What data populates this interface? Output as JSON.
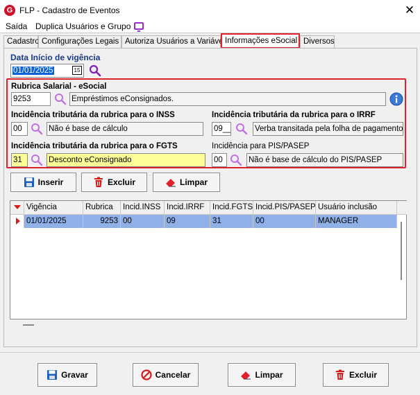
{
  "window": {
    "title": "FLP - Cadastro de Eventos",
    "logo_letter": "G",
    "close": "✕"
  },
  "menu": {
    "saida": "Saída",
    "duplica": "Duplica Usuários e Grupo"
  },
  "tabs": [
    "Cadastro",
    "Configurações Legais",
    "Autoriza Usuários a Variáveis",
    "Informações eSocial",
    "Diversos"
  ],
  "vigencia": {
    "label": "Data Início de vigência",
    "value": "01/01/2025",
    "cal": "15"
  },
  "rubrica": {
    "label": "Rubrica Salarial - eSocial",
    "code": "9253",
    "desc": "Empréstimos eConsignados."
  },
  "inss": {
    "label": "Incidência tributária da rubrica para o INSS",
    "code": "00",
    "desc": "Não é base de cálculo"
  },
  "irrf": {
    "label": "Incidência tributária da rubrica para o IRRF",
    "code": "09__",
    "desc": "Verba transitada pela folha de pagamento de"
  },
  "fgts": {
    "label": "Incidência tributária da rubrica para o FGTS",
    "code": "31",
    "desc": "Desconto eConsignado"
  },
  "pis": {
    "label": "Incidência para PIS/PASEP",
    "code": "00",
    "desc": "Não é base de cálculo do PIS/PASEP"
  },
  "actions": {
    "inserir": "Inserir",
    "excluir": "Excluir",
    "limpar": "Limpar"
  },
  "grid": {
    "headers": [
      "Vigência",
      "Rubrica",
      "Incid.INSS",
      "Incid.IRRF",
      "Incid.FGTS",
      "Incid.PIS/PASEP",
      "Usuário inclusão"
    ],
    "rows": [
      {
        "vigencia": "01/01/2025",
        "rubrica": "9253",
        "inss": "00",
        "irrf": "09",
        "fgts": "31",
        "pis": "00",
        "usuario": "MANAGER"
      }
    ]
  },
  "footer": {
    "gravar": "Gravar",
    "cancelar": "Cancelar",
    "limpar": "Limpar",
    "excluir": "Excluir"
  },
  "colors": {
    "accent_red": "#e0202a",
    "selection": "#8fb1e8",
    "highlight": "#ffff99",
    "label_blue": "#1a3a8a"
  }
}
